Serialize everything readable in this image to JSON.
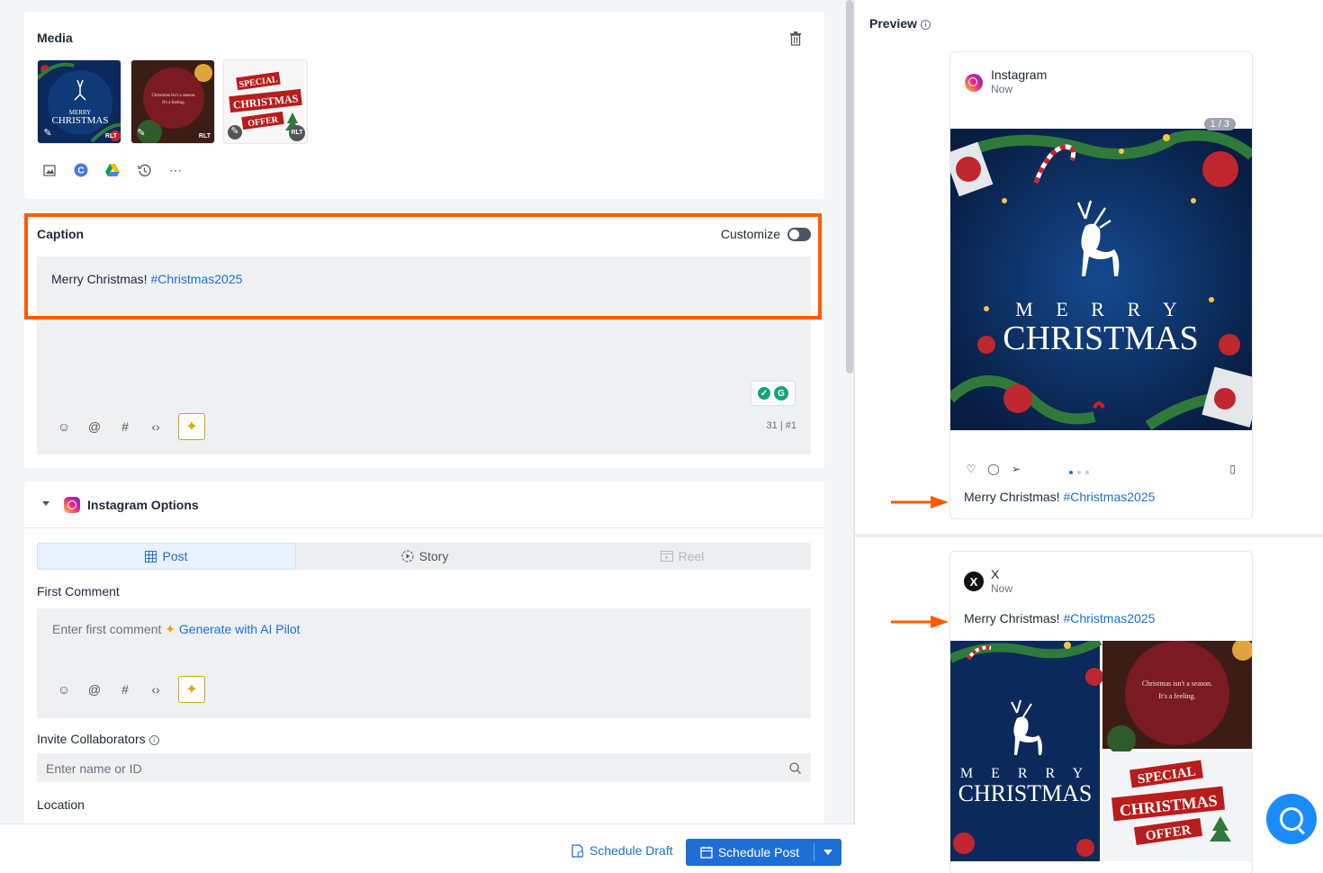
{
  "media": {
    "title": "Media",
    "thumbs": [
      {
        "lines": [
          "MERRY",
          "CHRISTMAS"
        ],
        "badge": "RLT"
      },
      {
        "lines": [
          "Christmas isn't a season.",
          "It's a feeling."
        ],
        "badge": "RLT"
      },
      {
        "lines": [
          "SPECIAL",
          "CHRISTMAS",
          "OFFER"
        ],
        "badge": "RLT"
      }
    ],
    "tools": [
      "image-upload-icon",
      "canva-icon",
      "google-drive-icon",
      "history-icon",
      "more-icon"
    ]
  },
  "caption": {
    "title": "Caption",
    "customize_label": "Customize",
    "text": "Merry Christmas! ",
    "hashtag": "#Christmas2025",
    "counter": "31",
    "counter_tag": "#1"
  },
  "instagram_options": {
    "title": "Instagram Options",
    "tabs": [
      "Post",
      "Story",
      "Reel"
    ],
    "first_comment_label": "First Comment",
    "first_comment_placeholder": "Enter first comment",
    "generate_label": "Generate with AI Pilot",
    "collaborators_label": "Invite Collaborators",
    "collaborators_placeholder": "Enter name or ID",
    "location_label": "Location"
  },
  "footer": {
    "draft_label": "Schedule Draft",
    "schedule_label": "Schedule Post"
  },
  "preview": {
    "title": "Preview",
    "instagram": {
      "name": "Instagram",
      "time": "Now",
      "pager": "1 / 3",
      "image_line1": "M E R R Y",
      "image_line2": "CHRISTMAS",
      "caption": "Merry Christmas! ",
      "hashtag": "#Christmas2025"
    },
    "x": {
      "name": "X",
      "time": "Now",
      "caption": "Merry Christmas! ",
      "hashtag": "#Christmas2025",
      "img1_line1": "M E R R Y",
      "img1_line2": "CHRISTMAS",
      "img2_quote": "Christmas isn't a season.",
      "img2_quote2": "It's a feeling.",
      "img3_lines": [
        "SPECIAL",
        "CHRISTMAS",
        "OFFER"
      ]
    }
  },
  "colors": {
    "accent": "#1d6fd6",
    "highlight": "#ff5a00",
    "christmas_blue": "#0b2a5b",
    "christmas_red": "#7a1a22"
  }
}
